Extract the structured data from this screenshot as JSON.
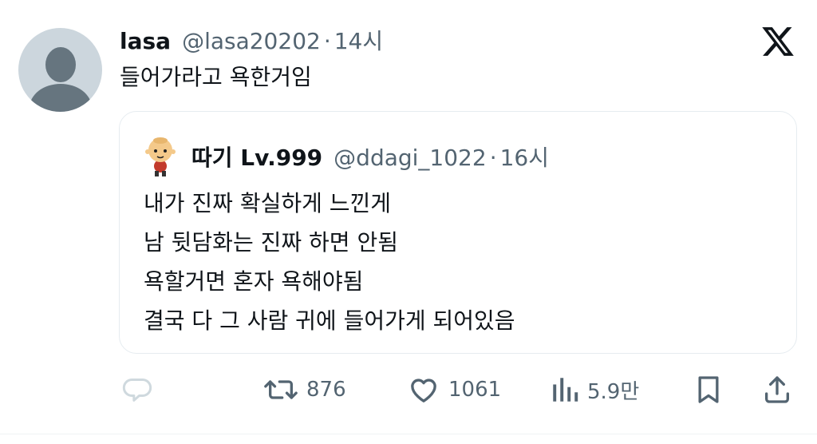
{
  "tweet": {
    "author_name": "lasa",
    "author_handle": "@lasa20202",
    "separator": "·",
    "time": "14시",
    "text": "들어가라고 욕한거임"
  },
  "quoted": {
    "author_name": "따기 Lv.999",
    "author_handle": "@ddagi_1022",
    "separator": "·",
    "time": "16시",
    "lines": [
      "내가 진짜 확실하게 느낀게",
      "남 뒷담화는 진짜 하면 안됨",
      "욕할거면 혼자 욕해야됨",
      "결국 다 그 사람 귀에 들어가게 되어있음"
    ]
  },
  "actions": {
    "reply_icon": "reply-icon",
    "retweet_icon": "retweet-icon",
    "retweet_count": "876",
    "like_icon": "heart-icon",
    "like_count": "1061",
    "views_icon": "bar-chart-icon",
    "views_count": "5.9만",
    "bookmark_icon": "bookmark-icon",
    "share_icon": "share-icon"
  },
  "colors": {
    "text": "#0f1419",
    "muted": "#536471",
    "border": "#e6ecf0",
    "avatar_bg": "#ccd6dd",
    "avatar_fg": "#66757f"
  }
}
